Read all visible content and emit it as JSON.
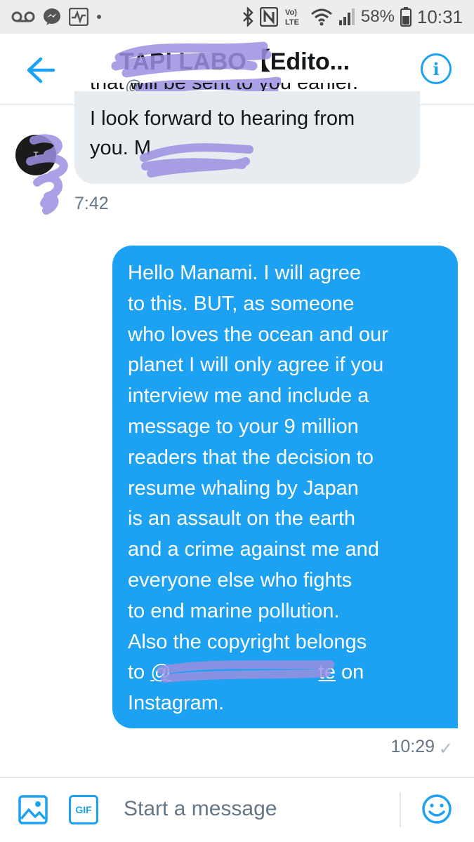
{
  "status_bar": {
    "battery_percent": "58%",
    "time": "10:31",
    "icons": [
      "voicemail-icon",
      "messenger-icon",
      "activity-icon",
      "bluetooth-icon",
      "nfc-icon",
      "volte-icon",
      "wifi-icon",
      "signal-icon",
      "battery-icon"
    ]
  },
  "header": {
    "title": "TAPI LABO【Edito...",
    "handle": "@",
    "back_icon": "arrow-left-icon",
    "info_icon": "info-icon"
  },
  "conversation": {
    "incoming": {
      "partial_line": "that will be sent to you earlier.",
      "text_line1": "I look forward to hearing from",
      "text_line2": "you. M",
      "avatar_letter": "T",
      "time": "7:42"
    },
    "outgoing": {
      "text": "Hello Manami. I will agree\nto this. BUT, as someone\nwho loves the ocean and our\nplanet I will only agree if you\ninterview me and include a\nmessage to your 9 million\nreaders that the decision to\nresume whaling by Japan\nis an assault on the earth\nand a crime against me and\neveryone else who fights\nto end marine pollution.\nAlso the copyright belongs",
      "line_to": "to ",
      "link": "@",
      "link_tail": "te",
      "line_on": " on",
      "last_line": "Instagram.",
      "time": "10:29",
      "status_icon": "check-icon"
    }
  },
  "composer": {
    "placeholder": "Start a message",
    "gif_label": "GIF",
    "image_icon": "image-icon",
    "emoji_icon": "emoji-icon"
  },
  "colors": {
    "accent": "#1da1f2",
    "incoming_bubble": "#e6ecf0",
    "secondary_text": "#657786",
    "status_bar_bg": "#ededed",
    "redaction": "#9b8fe0"
  }
}
